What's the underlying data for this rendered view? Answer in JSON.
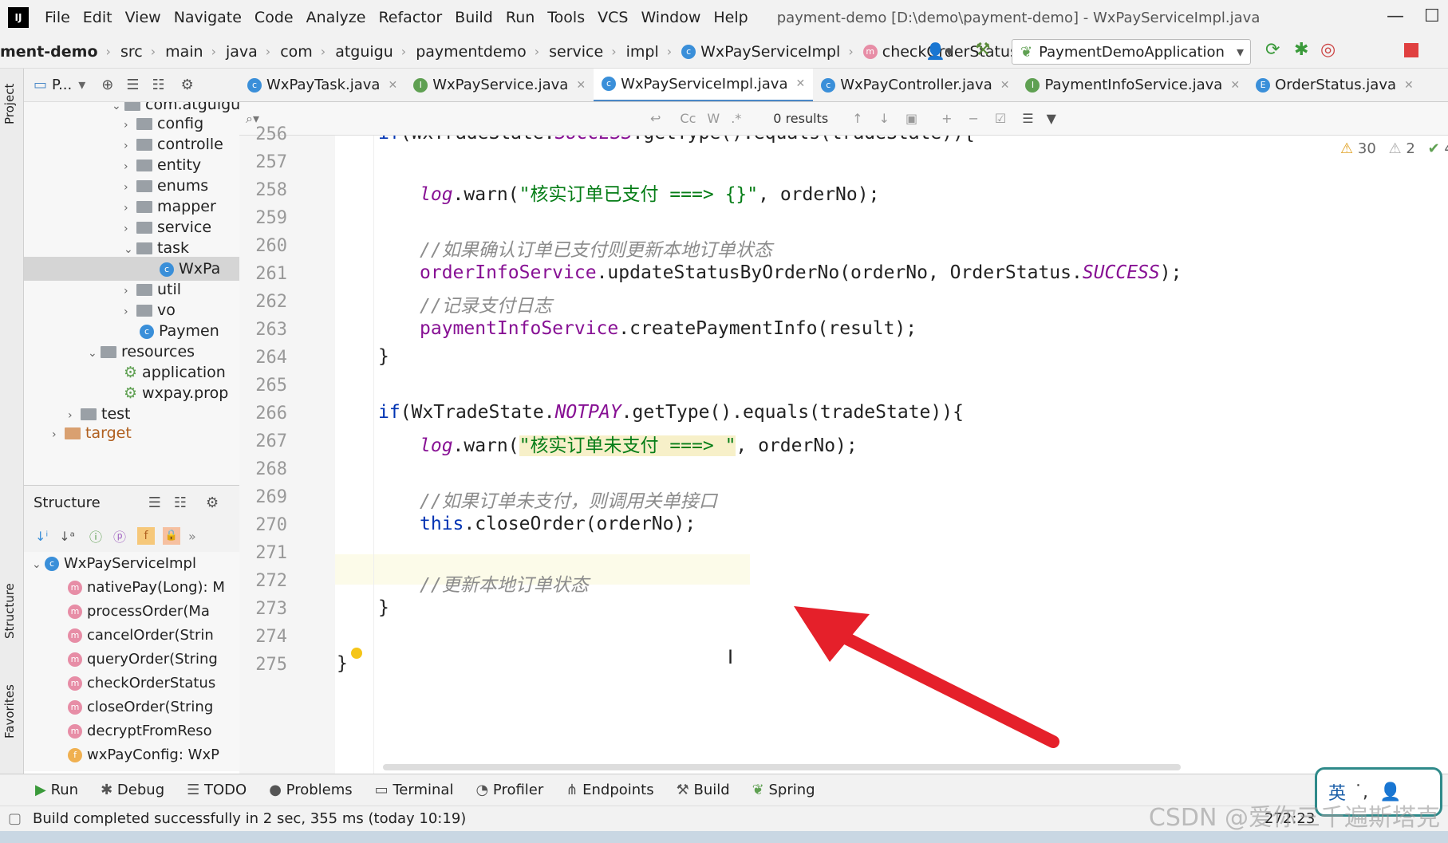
{
  "menubar": {
    "app_logo": "IJ",
    "items": [
      "File",
      "Edit",
      "View",
      "Navigate",
      "Code",
      "Analyze",
      "Refactor",
      "Build",
      "Run",
      "Tools",
      "VCS",
      "Window",
      "Help"
    ],
    "window_title": "payment-demo [D:\\demo\\payment-demo] - WxPayServiceImpl.java"
  },
  "breadcrumb": {
    "items": [
      "ment-demo",
      "src",
      "main",
      "java",
      "com",
      "atguigu",
      "paymentdemo",
      "service",
      "impl",
      "WxPayServiceImpl",
      "checkOrderStatus"
    ]
  },
  "run_config": {
    "label": "PaymentDemoApplication"
  },
  "project_panel": {
    "title": "P..."
  },
  "tree": {
    "rows": [
      {
        "label": "com.atguigu",
        "arrow": "",
        "indent": 0
      },
      {
        "label": "config",
        "arrow": ">",
        "indent": 1
      },
      {
        "label": "controlle",
        "arrow": ">",
        "indent": 1
      },
      {
        "label": "entity",
        "arrow": ">",
        "indent": 1
      },
      {
        "label": "enums",
        "arrow": ">",
        "indent": 1
      },
      {
        "label": "mapper",
        "arrow": ">",
        "indent": 1
      },
      {
        "label": "service",
        "arrow": ">",
        "indent": 1
      },
      {
        "label": "task",
        "arrow": "v",
        "indent": 1
      },
      {
        "label": "WxPa",
        "arrow": "",
        "indent": 2
      },
      {
        "label": "util",
        "arrow": ">",
        "indent": 1
      },
      {
        "label": "vo",
        "arrow": ">",
        "indent": 1
      },
      {
        "label": "Paymen",
        "arrow": "",
        "indent": 1
      },
      {
        "label": "resources",
        "arrow": "v",
        "indent": 0
      },
      {
        "label": "application",
        "arrow": "",
        "indent": 1
      },
      {
        "label": "wxpay.prop",
        "arrow": "",
        "indent": 1
      },
      {
        "label": "test",
        "arrow": ">",
        "indent": -1
      },
      {
        "label": "target",
        "arrow": ">",
        "indent": -2
      }
    ]
  },
  "structure": {
    "title": "Structure",
    "root": "WxPayServiceImpl",
    "items": [
      {
        "label": "nativePay(Long): M",
        "kind": "m"
      },
      {
        "label": "processOrder(Ma",
        "kind": "m"
      },
      {
        "label": "cancelOrder(Strin",
        "kind": "m"
      },
      {
        "label": "queryOrder(String",
        "kind": "m"
      },
      {
        "label": "checkOrderStatus",
        "kind": "m"
      },
      {
        "label": "closeOrder(String",
        "kind": "m"
      },
      {
        "label": "decryptFromReso",
        "kind": "m"
      },
      {
        "label": "wxPayConfig: WxP",
        "kind": "f"
      }
    ]
  },
  "side_labels": {
    "project": "Project",
    "structure": "Structure",
    "favorites": "Favorites"
  },
  "tabs": [
    {
      "label": "WxPayTask.java",
      "kind": "c",
      "active": false
    },
    {
      "label": "WxPayService.java",
      "kind": "i",
      "active": false
    },
    {
      "label": "WxPayServiceImpl.java",
      "kind": "c",
      "active": true
    },
    {
      "label": "WxPayController.java",
      "kind": "c",
      "active": false
    },
    {
      "label": "PaymentInfoService.java",
      "kind": "i",
      "active": false
    },
    {
      "label": "OrderStatus.java",
      "kind": "e",
      "active": false
    }
  ],
  "findbar": {
    "results": "0 results",
    "match_case": "Cc",
    "words": "W",
    "regex": ".*"
  },
  "inspections": {
    "warnings": "30",
    "weak": "2",
    "ok": "4"
  },
  "editor": {
    "lines": [
      {
        "n": "256",
        "t": "if(WxTradeState.SUCCESS.getType().equals(tradeState)){"
      },
      {
        "n": "257",
        "t": ""
      },
      {
        "n": "258",
        "t": "log.warn(\"核实订单已支付 ===> {}\", orderNo);"
      },
      {
        "n": "259",
        "t": ""
      },
      {
        "n": "260",
        "t": "//如果确认订单已支付则更新本地订单状态"
      },
      {
        "n": "261",
        "t": "orderInfoService.updateStatusByOrderNo(orderNo, OrderStatus.SUCCESS);"
      },
      {
        "n": "262",
        "t": "//记录支付日志"
      },
      {
        "n": "263",
        "t": "paymentInfoService.createPaymentInfo(result);"
      },
      {
        "n": "264",
        "t": "}"
      },
      {
        "n": "265",
        "t": ""
      },
      {
        "n": "266",
        "t": "if(WxTradeState.NOTPAY.getType().equals(tradeState)){"
      },
      {
        "n": "267",
        "t": "log.warn(\"核实订单未支付 ===> \", orderNo);"
      },
      {
        "n": "268",
        "t": ""
      },
      {
        "n": "269",
        "t": "//如果订单未支付，则调用关单接口"
      },
      {
        "n": "270",
        "t": "this.closeOrder(orderNo);"
      },
      {
        "n": "271",
        "t": ""
      },
      {
        "n": "272",
        "t": "//更新本地订单状态"
      },
      {
        "n": "273",
        "t": "}"
      },
      {
        "n": "274",
        "t": ""
      },
      {
        "n": "275",
        "t": "}"
      }
    ]
  },
  "bottom_tools": [
    "Run",
    "Debug",
    "TODO",
    "Problems",
    "Terminal",
    "Profiler",
    "Endpoints",
    "Build",
    "Spring"
  ],
  "status": {
    "message": "Build completed successfully in 2 sec, 355 ms (today 10:19)",
    "position": "272:23"
  },
  "watermark": "CSDN @爱你三千遍斯塔克",
  "ime": {
    "label": "英"
  },
  "colors": {
    "keyword": "#0033b3",
    "string": "#067d17",
    "comment": "#8c8c8c",
    "static_field": "#871094",
    "arrow": "#e5202a",
    "active_tab": "#4a88c7"
  }
}
